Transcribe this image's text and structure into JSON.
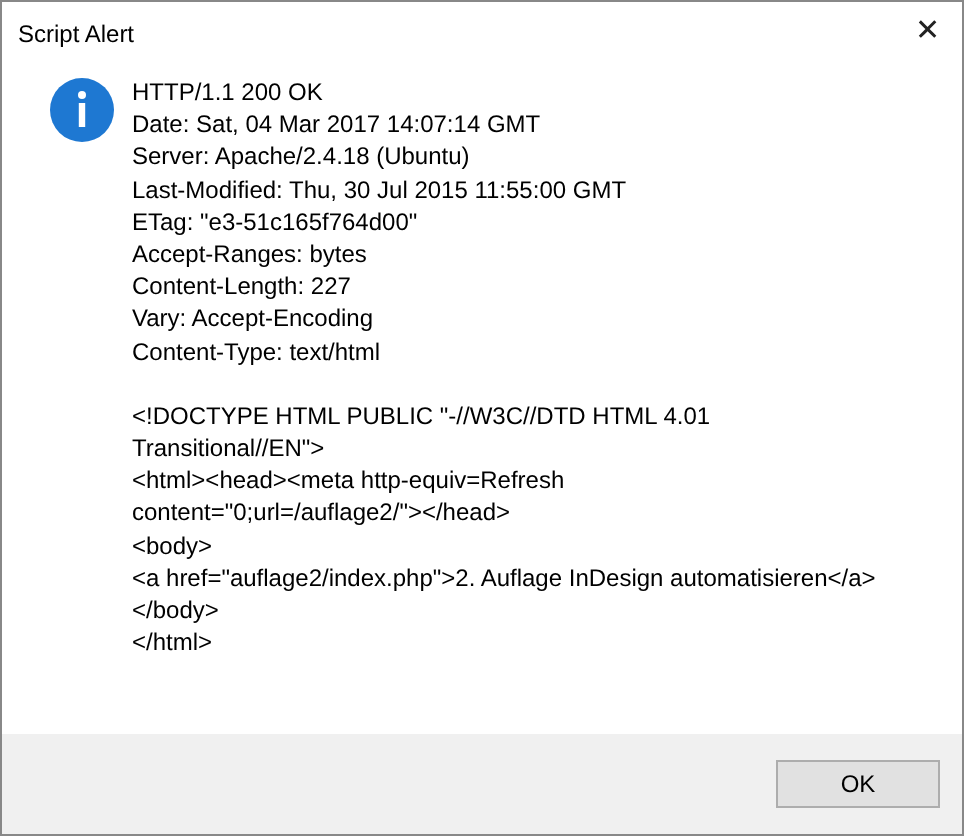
{
  "window": {
    "title": "Script Alert",
    "close": "✕"
  },
  "message": {
    "header_lines": [
      "HTTP/1.1 200 OK",
      "Date: Sat, 04 Mar 2017 14:07:14 GMT",
      "Server: Apache/2.4.18 (Ubuntu)",
      "Last-Modified: Thu, 30 Jul 2015 11:55:00 GMT",
      "ETag: \"e3-51c165f764d00\"",
      "Accept-Ranges: bytes",
      "Content-Length: 227",
      "Vary: Accept-Encoding",
      "Content-Type: text/html"
    ],
    "body_lines": [
      "<!DOCTYPE HTML PUBLIC \"-//W3C//DTD HTML 4.01",
      "Transitional//EN\">",
      "<html><head><meta http-equiv=Refresh",
      "content=\"0;url=/auflage2/\"></head>",
      "<body>",
      "<a href=\"auflage2/index.php\">2. Auflage InDesign automatisieren</a>",
      "</body>",
      "</html>"
    ]
  },
  "buttons": [
    "OK"
  ]
}
